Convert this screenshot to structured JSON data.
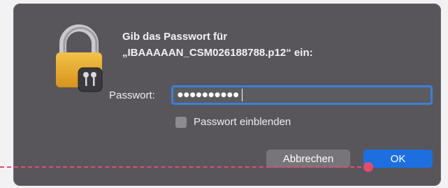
{
  "dialog": {
    "prompt_line1": "Gib das Passwort für",
    "prompt_line2": "„IBAAAAAN_CSM026188788.p12“ ein:",
    "lock_icon": "keychain-lock-icon"
  },
  "password": {
    "label": "Passwort:",
    "masked_value": "●●●●●●●●●●"
  },
  "show_password": {
    "label": "Passwort einblenden",
    "checked": false
  },
  "buttons": {
    "cancel_label": "Abbrechen",
    "ok_label": "OK"
  },
  "colors": {
    "dialog_bg": "#58565b",
    "accent": "#1d6fe0",
    "annotation": "#e44c6c"
  }
}
